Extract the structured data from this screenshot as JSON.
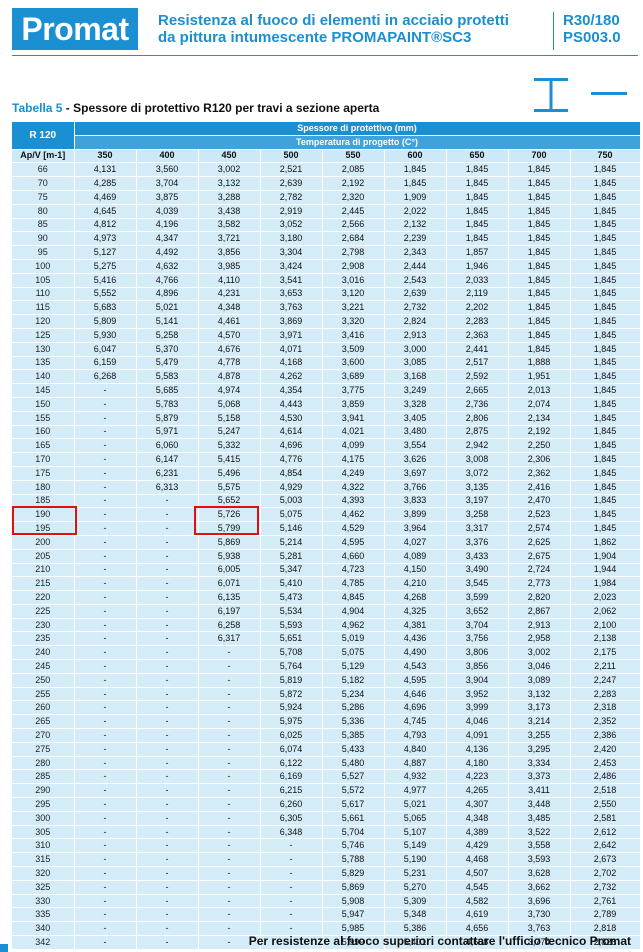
{
  "header": {
    "logo_text": "Promat",
    "title_line1": "Resistenza al fuoco di elementi in acciaio protetti",
    "title_line2": "da pittura intumescente PROMAPAINT®SC3",
    "code_line1": "R30/180",
    "code_line2": "PS003.0"
  },
  "table": {
    "label": "Tabella 5",
    "title": " - Spessore di protettivo R120 per travi a sezione aperta",
    "corner_label": "R 120",
    "group_header": "Spessore di protettivo (mm)",
    "sub_header": "Temperatura di progetto (C°)",
    "row_header_label": "Ap/V [m-1]",
    "columns": [
      "350",
      "400",
      "450",
      "500",
      "550",
      "600",
      "650",
      "700",
      "750"
    ],
    "rows": [
      [
        "66",
        "4,131",
        "3,560",
        "3,002",
        "2,521",
        "2,085",
        "1,845",
        "1,845",
        "1,845",
        "1,845"
      ],
      [
        "70",
        "4,285",
        "3,704",
        "3,132",
        "2,639",
        "2,192",
        "1,845",
        "1,845",
        "1,845",
        "1,845"
      ],
      [
        "75",
        "4,469",
        "3,875",
        "3,288",
        "2,782",
        "2,320",
        "1,909",
        "1,845",
        "1,845",
        "1,845"
      ],
      [
        "80",
        "4,645",
        "4,039",
        "3,438",
        "2,919",
        "2,445",
        "2,022",
        "1,845",
        "1,845",
        "1,845"
      ],
      [
        "85",
        "4,812",
        "4,196",
        "3,582",
        "3,052",
        "2,566",
        "2,132",
        "1,845",
        "1,845",
        "1,845"
      ],
      [
        "90",
        "4,973",
        "4,347",
        "3,721",
        "3,180",
        "2,684",
        "2,239",
        "1,845",
        "1,845",
        "1,845"
      ],
      [
        "95",
        "5,127",
        "4,492",
        "3,856",
        "3,304",
        "2,798",
        "2,343",
        "1,857",
        "1,845",
        "1,845"
      ],
      [
        "100",
        "5,275",
        "4,632",
        "3,985",
        "3,424",
        "2,908",
        "2,444",
        "1,946",
        "1,845",
        "1,845"
      ],
      [
        "105",
        "5,416",
        "4,766",
        "4,110",
        "3,541",
        "3,016",
        "2,543",
        "2,033",
        "1,845",
        "1,845"
      ],
      [
        "110",
        "5,552",
        "4,896",
        "4,231",
        "3,653",
        "3,120",
        "2,639",
        "2,119",
        "1,845",
        "1,845"
      ],
      [
        "115",
        "5,683",
        "5,021",
        "4,348",
        "3,763",
        "3,221",
        "2,732",
        "2,202",
        "1,845",
        "1,845"
      ],
      [
        "120",
        "5,809",
        "5,141",
        "4,461",
        "3,869",
        "3,320",
        "2,824",
        "2,283",
        "1,845",
        "1,845"
      ],
      [
        "125",
        "5,930",
        "5,258",
        "4,570",
        "3,971",
        "3,416",
        "2,913",
        "2,363",
        "1,845",
        "1,845"
      ],
      [
        "130",
        "6,047",
        "5,370",
        "4,676",
        "4,071",
        "3,509",
        "3,000",
        "2,441",
        "1,845",
        "1,845"
      ],
      [
        "135",
        "6,159",
        "5,479",
        "4,778",
        "4,168",
        "3,600",
        "3,085",
        "2,517",
        "1,888",
        "1,845"
      ],
      [
        "140",
        "6,268",
        "5,583",
        "4,878",
        "4,262",
        "3,689",
        "3,168",
        "2,592",
        "1,951",
        "1,845"
      ],
      [
        "145",
        "-",
        "5,685",
        "4,974",
        "4,354",
        "3,775",
        "3,249",
        "2,665",
        "2,013",
        "1,845"
      ],
      [
        "150",
        "-",
        "5,783",
        "5,068",
        "4,443",
        "3,859",
        "3,328",
        "2,736",
        "2,074",
        "1,845"
      ],
      [
        "155",
        "-",
        "5,879",
        "5,158",
        "4,530",
        "3,941",
        "3,405",
        "2,806",
        "2,134",
        "1,845"
      ],
      [
        "160",
        "-",
        "5,971",
        "5,247",
        "4,614",
        "4,021",
        "3,480",
        "2,875",
        "2,192",
        "1,845"
      ],
      [
        "165",
        "-",
        "6,060",
        "5,332",
        "4,696",
        "4,099",
        "3,554",
        "2,942",
        "2,250",
        "1,845"
      ],
      [
        "170",
        "-",
        "6,147",
        "5,415",
        "4,776",
        "4,175",
        "3,626",
        "3,008",
        "2,306",
        "1,845"
      ],
      [
        "175",
        "-",
        "6,231",
        "5,496",
        "4,854",
        "4,249",
        "3,697",
        "3,072",
        "2,362",
        "1,845"
      ],
      [
        "180",
        "-",
        "6,313",
        "5,575",
        "4,929",
        "4,322",
        "3,766",
        "3,135",
        "2,416",
        "1,845"
      ],
      [
        "185",
        "-",
        "-",
        "5,652",
        "5,003",
        "4,393",
        "3,833",
        "3,197",
        "2,470",
        "1,845"
      ],
      [
        "190",
        "-",
        "-",
        "5,726",
        "5,075",
        "4,462",
        "3,899",
        "3,258",
        "2,523",
        "1,845"
      ],
      [
        "195",
        "-",
        "-",
        "5,799",
        "5,146",
        "4,529",
        "3,964",
        "3,317",
        "2,574",
        "1,845"
      ],
      [
        "200",
        "-",
        "-",
        "5,869",
        "5,214",
        "4,595",
        "4,027",
        "3,376",
        "2,625",
        "1,862"
      ],
      [
        "205",
        "-",
        "-",
        "5,938",
        "5,281",
        "4,660",
        "4,089",
        "3,433",
        "2,675",
        "1,904"
      ],
      [
        "210",
        "-",
        "-",
        "6,005",
        "5,347",
        "4,723",
        "4,150",
        "3,490",
        "2,724",
        "1,944"
      ],
      [
        "215",
        "-",
        "-",
        "6,071",
        "5,410",
        "4,785",
        "4,210",
        "3,545",
        "2,773",
        "1,984"
      ],
      [
        "220",
        "-",
        "-",
        "6,135",
        "5,473",
        "4,845",
        "4,268",
        "3,599",
        "2,820",
        "2,023"
      ],
      [
        "225",
        "-",
        "-",
        "6,197",
        "5,534",
        "4,904",
        "4,325",
        "3,652",
        "2,867",
        "2,062"
      ],
      [
        "230",
        "-",
        "-",
        "6,258",
        "5,593",
        "4,962",
        "4,381",
        "3,704",
        "2,913",
        "2,100"
      ],
      [
        "235",
        "-",
        "-",
        "6,317",
        "5,651",
        "5,019",
        "4,436",
        "3,756",
        "2,958",
        "2,138"
      ],
      [
        "240",
        "-",
        "-",
        "-",
        "5,708",
        "5,075",
        "4,490",
        "3,806",
        "3,002",
        "2,175"
      ],
      [
        "245",
        "-",
        "-",
        "-",
        "5,764",
        "5,129",
        "4,543",
        "3,856",
        "3,046",
        "2,211"
      ],
      [
        "250",
        "-",
        "-",
        "-",
        "5,819",
        "5,182",
        "4,595",
        "3,904",
        "3,089",
        "2,247"
      ],
      [
        "255",
        "-",
        "-",
        "-",
        "5,872",
        "5,234",
        "4,646",
        "3,952",
        "3,132",
        "2,283"
      ],
      [
        "260",
        "-",
        "-",
        "-",
        "5,924",
        "5,286",
        "4,696",
        "3,999",
        "3,173",
        "2,318"
      ],
      [
        "265",
        "-",
        "-",
        "-",
        "5,975",
        "5,336",
        "4,745",
        "4,046",
        "3,214",
        "2,352"
      ],
      [
        "270",
        "-",
        "-",
        "-",
        "6,025",
        "5,385",
        "4,793",
        "4,091",
        "3,255",
        "2,386"
      ],
      [
        "275",
        "-",
        "-",
        "-",
        "6,074",
        "5,433",
        "4,840",
        "4,136",
        "3,295",
        "2,420"
      ],
      [
        "280",
        "-",
        "-",
        "-",
        "6,122",
        "5,480",
        "4,887",
        "4,180",
        "3,334",
        "2,453"
      ],
      [
        "285",
        "-",
        "-",
        "-",
        "6,169",
        "5,527",
        "4,932",
        "4,223",
        "3,373",
        "2,486"
      ],
      [
        "290",
        "-",
        "-",
        "-",
        "6,215",
        "5,572",
        "4,977",
        "4,265",
        "3,411",
        "2,518"
      ],
      [
        "295",
        "-",
        "-",
        "-",
        "6,260",
        "5,617",
        "5,021",
        "4,307",
        "3,448",
        "2,550"
      ],
      [
        "300",
        "-",
        "-",
        "-",
        "6,305",
        "5,661",
        "5,065",
        "4,348",
        "3,485",
        "2,581"
      ],
      [
        "305",
        "-",
        "-",
        "-",
        "6,348",
        "5,704",
        "5,107",
        "4,389",
        "3,522",
        "2,612"
      ],
      [
        "310",
        "-",
        "-",
        "-",
        "-",
        "5,746",
        "5,149",
        "4,429",
        "3,558",
        "2,642"
      ],
      [
        "315",
        "-",
        "-",
        "-",
        "-",
        "5,788",
        "5,190",
        "4,468",
        "3,593",
        "2,673"
      ],
      [
        "320",
        "-",
        "-",
        "-",
        "-",
        "5,829",
        "5,231",
        "4,507",
        "3,628",
        "2,702"
      ],
      [
        "325",
        "-",
        "-",
        "-",
        "-",
        "5,869",
        "5,270",
        "4,545",
        "3,662",
        "2,732"
      ],
      [
        "330",
        "-",
        "-",
        "-",
        "-",
        "5,908",
        "5,309",
        "4,582",
        "3,696",
        "2,761"
      ],
      [
        "335",
        "-",
        "-",
        "-",
        "-",
        "5,947",
        "5,348",
        "4,619",
        "3,730",
        "2,789"
      ],
      [
        "340",
        "-",
        "-",
        "-",
        "-",
        "5,985",
        "5,386",
        "4,656",
        "3,763",
        "2,818"
      ],
      [
        "342",
        "-",
        "-",
        "-",
        "-",
        "5,999",
        "5,401",
        "4,668",
        "3,774",
        "2,828"
      ]
    ]
  },
  "footer": {
    "note": "Per resistenze al fuoco superiori contattare l'ufficio tecnico Promat"
  },
  "colors": {
    "brand_blue": "#1a8fd1",
    "cell_bg": "#d4ecf8",
    "highlight_red": "#e01010"
  }
}
